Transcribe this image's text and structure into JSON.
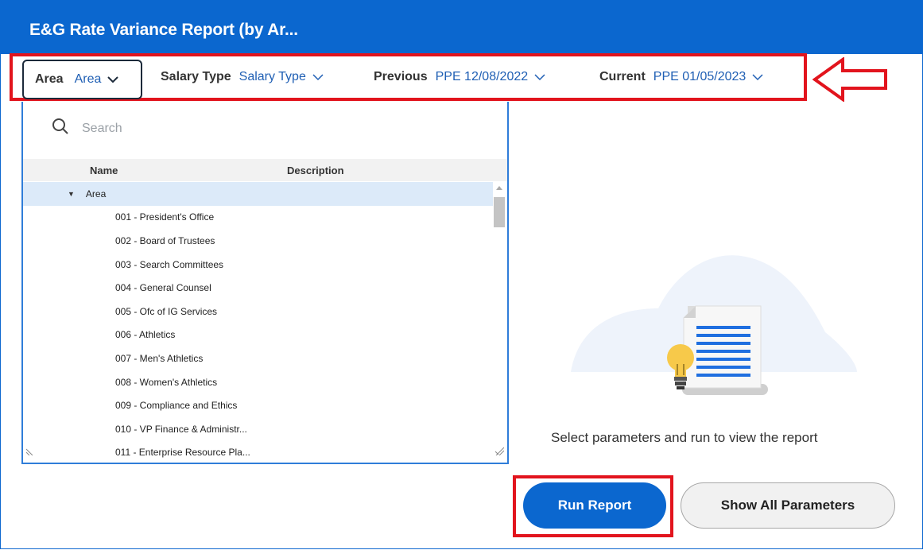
{
  "header": {
    "title": "E&G Rate Variance Report (by Ar..."
  },
  "filters": {
    "area": {
      "label": "Area",
      "value": "Area"
    },
    "salary_type": {
      "label": "Salary Type",
      "value": "Salary Type"
    },
    "previous": {
      "label": "Previous",
      "value": "PPE 12/08/2022"
    },
    "current": {
      "label": "Current",
      "value": "PPE 01/05/2023"
    }
  },
  "dropdown": {
    "search_placeholder": "Search",
    "columns": {
      "name": "Name",
      "description": "Description"
    },
    "root": "Area",
    "items": [
      "001 - President's Office",
      "002 - Board of Trustees",
      "003 - Search Committees",
      "004 - General Counsel",
      "005 - Ofc of IG Services",
      "006 - Athletics",
      "007 - Men's Athletics",
      "008 - Women's Athletics",
      "009 - Compliance and Ethics",
      "010 - VP Finance & Administr...",
      "011 - Enterprise Resource Pla..."
    ]
  },
  "empty_state": {
    "message": "Select parameters and run to view the report"
  },
  "actions": {
    "run_report": "Run Report",
    "show_all": "Show All Parameters"
  },
  "colors": {
    "header": "#0b67cf",
    "highlight": "#e2141d",
    "link": "#1f5fb4",
    "selected_row": "#dceaf9"
  }
}
